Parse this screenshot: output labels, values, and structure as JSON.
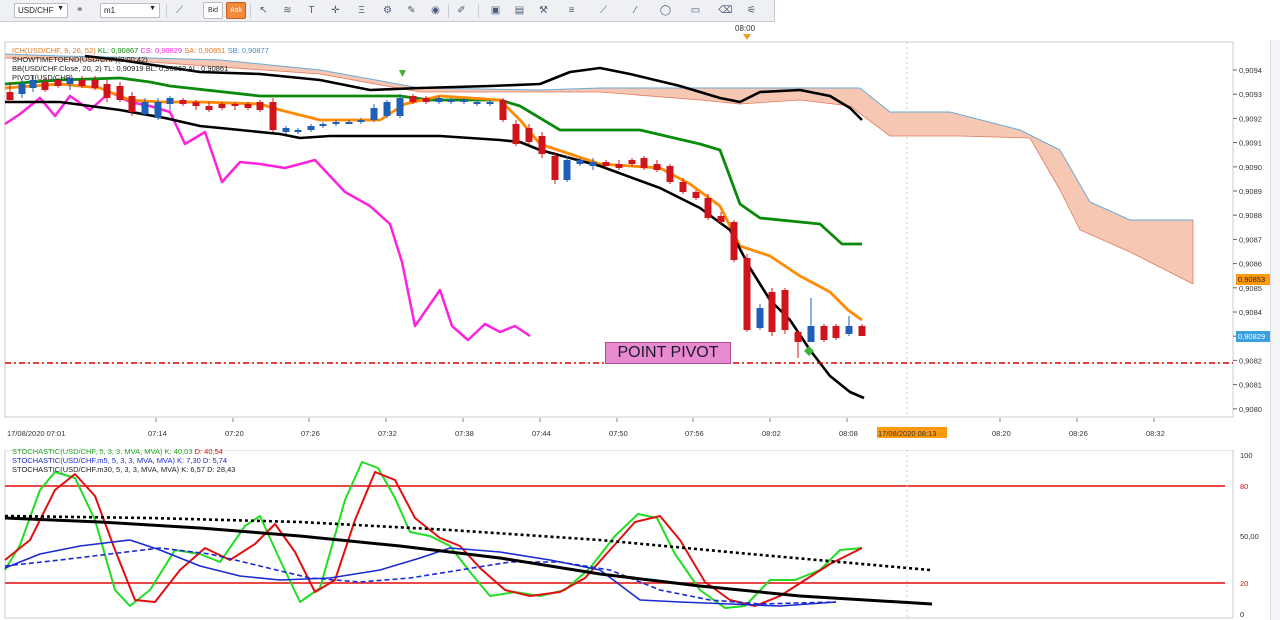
{
  "toolbar": {
    "symbol": "USD/CHF",
    "timeframe": "m1",
    "bid_label": "Bid",
    "ask_label": "Ask",
    "icons": [
      "line-chart-icon",
      "cursor-icon",
      "fibonacci-icon",
      "text-icon",
      "crosshair-icon",
      "globe-icon",
      "pencil-icon",
      "image-icon",
      "window-icon",
      "tools-icon",
      "menu-icon",
      "draw-icon",
      "brush-icon",
      "ellipse-icon",
      "rectangle-icon",
      "eraser-icon",
      "hierarchy-icon"
    ]
  },
  "top_time_label": "08:00",
  "main_legend": {
    "ich": "ICH(USD/CHF, 9, 26, 52)",
    "ich_kl": "KL: 0,90867",
    "ich_cs": "CS: 0,90829",
    "ich_sa": "SA: 0,90851",
    "ich_sb": "SB: 0,90877",
    "showtime": "SHOWTIMETOEND(USD/CHF)(0:00:42)",
    "bb": "BB(USD/CHF.Close, 20, 2)",
    "bb_tl": "TL: 0,90919",
    "bb_bl": "BL: 0,90803",
    "bb_al": "AL: 0,90861",
    "pivot": "PIVOT(USD/CHF)"
  },
  "pivot_label": "POINT PIVOT",
  "price_axis": [
    "0,9094",
    "0,9093",
    "0,9092",
    "0,9091",
    "0,9090",
    "0,9089",
    "0,9088",
    "0,9087",
    "0,9086",
    "0,9085",
    "0,9084",
    "0,9083",
    "0,9082",
    "0,9081",
    "0,9080"
  ],
  "price_badges": {
    "sa": "0,90853",
    "close": "0,90829"
  },
  "time_axis": [
    "17/08/2020 07:01",
    "07:14",
    "07:20",
    "07:26",
    "07:32",
    "07:38",
    "07:44",
    "07:50",
    "07:56",
    "08:02",
    "08:08",
    "17/08/2020 08:13",
    "08:20",
    "08:26",
    "08:32"
  ],
  "stoch_legend": {
    "s1": "STOCHASTIC(USD/CHF, 5, 3, 3, MVA, MVA)",
    "s1_k": "K: 40,03",
    "s1_d": "D: 40,54",
    "s2": "STOCHASTIC(USD/CHF.m5, 5, 3, 3, MVA, MVA)",
    "s2_k": "K: 7,30",
    "s2_d": "D: 5,74",
    "s3": "STOCHASTIC(USD/CHF.m30, 5, 3, 3, MVA, MVA)",
    "s3_k": "K: 6,57",
    "s3_d": "D: 28,43"
  },
  "stoch_axis": [
    "100",
    "80",
    "50,00",
    "20",
    "0"
  ],
  "colors": {
    "bull": "#1f5fb8",
    "bear": "#d0141c",
    "kijun": "#0a8a0a",
    "tenkan": "#ff8a00",
    "chikou": "#ff22dd",
    "bb": "#000000",
    "cloud_fill": "#f6c7b2",
    "cloud_line": "#6aaad8",
    "pivot": "#e00000",
    "stoch_k": "#22dd22",
    "stoch_d": "#e01010"
  }
}
